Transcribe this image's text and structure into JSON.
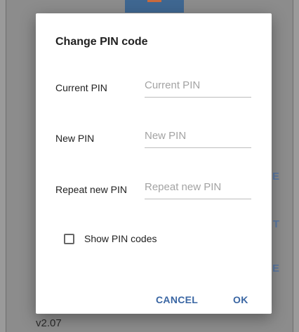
{
  "background": {
    "peek_labels": [
      "E",
      "T",
      "E"
    ],
    "version": "v2.07"
  },
  "dialog": {
    "title": "Change PIN code",
    "fields": [
      {
        "label": "Current PIN",
        "placeholder": "Current PIN",
        "value": ""
      },
      {
        "label": "New PIN",
        "placeholder": "New PIN",
        "value": ""
      },
      {
        "label": "Repeat new PIN",
        "placeholder": "Repeat new PIN",
        "value": ""
      }
    ],
    "show_codes": {
      "label": "Show PIN codes",
      "checked": false
    },
    "buttons": {
      "cancel": "CANCEL",
      "ok": "OK"
    }
  },
  "colors": {
    "accent": "#3a66a3",
    "scrim": "#8c8c8c",
    "dialog_bg": "#ffffff"
  }
}
